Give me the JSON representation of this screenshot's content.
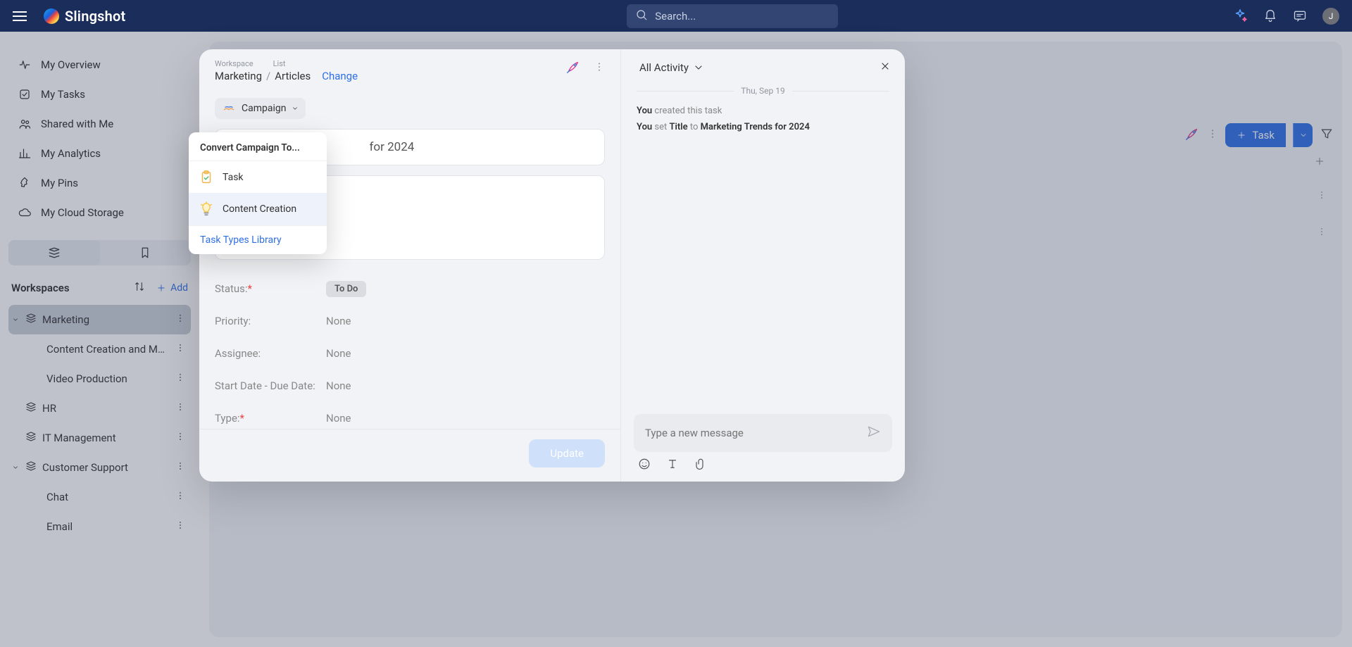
{
  "brand": "Slingshot",
  "search": {
    "placeholder": "Search..."
  },
  "avatar_initial": "J",
  "nav": [
    {
      "label": "My Overview"
    },
    {
      "label": "My Tasks"
    },
    {
      "label": "Shared with Me"
    },
    {
      "label": "My Analytics"
    },
    {
      "label": "My Pins"
    },
    {
      "label": "My Cloud Storage"
    }
  ],
  "workspaces": {
    "heading": "Workspaces",
    "add_label": "Add",
    "items": [
      {
        "label": "Marketing",
        "selected": true,
        "expanded": true,
        "children": [
          {
            "label": "Content Creation and Management"
          },
          {
            "label": "Video Production"
          }
        ]
      },
      {
        "label": "HR",
        "expanded": false
      },
      {
        "label": "IT Management",
        "expanded": false
      },
      {
        "label": "Customer Support",
        "expanded": true,
        "children": [
          {
            "label": "Chat"
          },
          {
            "label": "Email"
          }
        ]
      }
    ]
  },
  "view_actions": {
    "task_button": "Task"
  },
  "modal": {
    "crumb_labels": {
      "workspace": "Workspace",
      "list": "List"
    },
    "crumb_values": {
      "workspace": "Marketing",
      "list": "Articles"
    },
    "change_label": "Change",
    "type_chip": "Campaign",
    "title_suffix": "for 2024",
    "fields": {
      "status": {
        "label": "Status:",
        "required": true,
        "value": "To Do"
      },
      "priority": {
        "label": "Priority:",
        "value": "None"
      },
      "assignee": {
        "label": "Assignee:",
        "value": "None"
      },
      "dates": {
        "label": "Start Date - Due Date:",
        "value": "None"
      },
      "type": {
        "label": "Type:",
        "required": true,
        "value": "None"
      }
    },
    "update_button": "Update"
  },
  "popover": {
    "heading": "Convert Campaign To...",
    "items": [
      {
        "label": "Task"
      },
      {
        "label": "Content Creation"
      }
    ],
    "link": "Task Types Library"
  },
  "activity": {
    "dropdown": "All Activity",
    "date": "Thu, Sep 19",
    "logs": [
      {
        "actor": "You",
        "mid": " created this task",
        "bold2": ""
      },
      {
        "actor": "You",
        "mid": " set ",
        "bold1": "Title",
        "mid2": " to ",
        "bold2": "Marketing Trends for 2024"
      }
    ],
    "compose_placeholder": "Type a new message"
  }
}
